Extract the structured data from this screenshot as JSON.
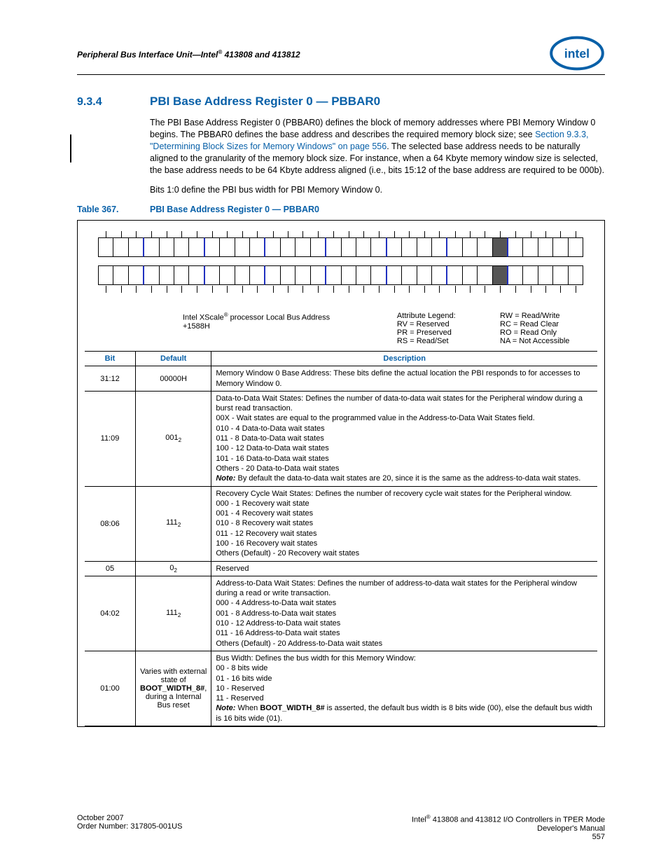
{
  "header": {
    "running_title_pre": "Peripheral Bus Interface Unit—Intel",
    "running_title_post": " 413808 and 413812",
    "reg_mark": "®"
  },
  "section": {
    "num": "9.3.4",
    "title": "PBI Base Address Register 0 — PBBAR0"
  },
  "para1_a": "The PBI Base Address Register 0 (PBBAR0) defines the block of memory addresses where PBI Memory Window 0 begins. The PBBAR0 defines the base address and describes the required memory block size; see ",
  "para1_xref": "Section 9.3.3, \"Determining Block Sizes for Memory Windows\" on page 556",
  "para1_b": ". The selected base address needs to be naturally aligned to the granularity of the memory block size. For instance, when a 64 Kbyte memory window size is selected, the base address needs to be 64 Kbyte address aligned (i.e., bits 15:12 of the base address are required to be 000b).",
  "para2": "Bits 1:0 define the PBI bus width for PBI Memory Window 0.",
  "table_label": {
    "num": "Table 367.",
    "title": "PBI Base Address Register 0 — PBBAR0"
  },
  "caption": {
    "left_a": "Intel XScale",
    "left_b": " processor Local Bus Address",
    "left_c": "+1588H",
    "mid_title": "Attribute Legend:",
    "mid_lines": [
      "RV = Reserved",
      "PR = Preserved",
      "RS = Read/Set"
    ],
    "right_lines": [
      "RW = Read/Write",
      "RC = Read Clear",
      "RO = Read Only",
      "NA = Not Accessible"
    ]
  },
  "th": {
    "bit": "Bit",
    "default": "Default",
    "desc": "Description"
  },
  "rows": [
    {
      "bit": "31:12",
      "def": "00000H",
      "desc": "Memory Window 0 Base Address: These bits define the actual location the PBI responds to for accesses to Memory Window 0."
    },
    {
      "bit": "11:09",
      "def": "001",
      "defsub": "2",
      "desc": "Data-to-Data Wait States: Defines the number of data-to-data wait states for the Peripheral window during a burst read transaction.\n00X - Wait states are equal to the programmed value in the Address-to-Data Wait States field.\n010 - 4 Data-to-Data wait states\n011 - 8 Data-to-Data wait states\n100 - 12 Data-to-Data wait states\n101 - 16 Data-to-Data wait states\nOthers - 20 Data-to-Data wait states",
      "note": "By default the data-to-data wait states are 20, since it is the same as the address-to-data wait states."
    },
    {
      "bit": "08:06",
      "def": "111",
      "defsub": "2",
      "desc": "Recovery Cycle Wait States: Defines the number of recovery cycle wait states for the Peripheral window.\n000 - 1 Recovery wait state\n001 - 4 Recovery wait states\n010 - 8 Recovery wait states\n011 - 12 Recovery wait states\n100 - 16 Recovery wait states\nOthers (Default) - 20 Recovery wait states"
    },
    {
      "bit": "05",
      "def": "0",
      "defsub": "2",
      "desc": "Reserved"
    },
    {
      "bit": "04:02",
      "def": "111",
      "defsub": "2",
      "desc": "Address-to-Data Wait States: Defines the number of address-to-data wait states for the Peripheral window during a read or write transaction.\n000 - 4 Address-to-Data wait states\n001 - 8 Address-to-Data wait states\n010 - 12 Address-to-Data wait states\n011 - 16 Address-to-Data wait states\nOthers (Default) - 20 Address-to-Data wait states"
    },
    {
      "bit": "01:00",
      "def_html": "Varies with external state of <b>BOOT_WIDTH_8#</b>, during a Internal Bus reset",
      "desc": "Bus Width: Defines the bus width for this Memory Window:\n00 - 8 bits wide\n01 - 16 bits wide\n10 - Reserved\n11 - Reserved",
      "note_html": "When <b>BOOT_WIDTH_8#</b> is asserted, the default bus width is 8 bits wide (00), else the default bus width is 16 bits wide (01)."
    }
  ],
  "footer": {
    "left1": "October 2007",
    "left2": "Order Number: 317805-001US",
    "right1_a": "Intel",
    "right1_b": " 413808 and 413812 I/O Controllers in TPER Mode",
    "right2": "Developer's Manual",
    "right3": "557"
  },
  "note_label": "Note:"
}
